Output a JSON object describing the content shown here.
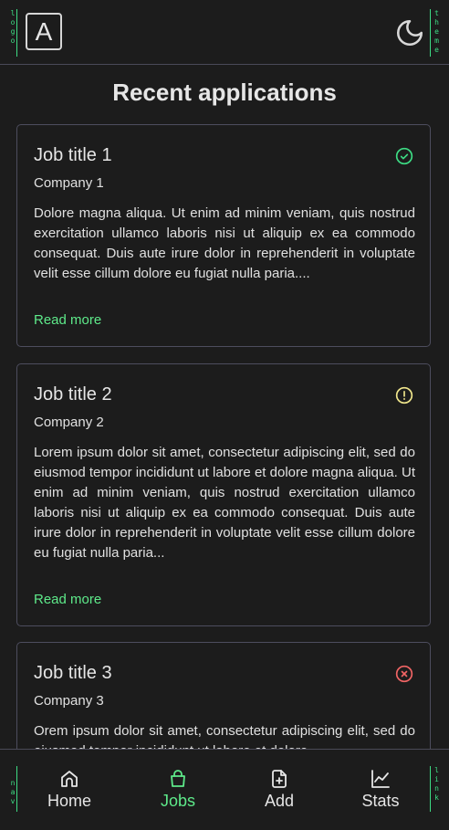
{
  "header": {
    "logo_letter": "A",
    "debug_left": [
      "l",
      "o",
      "g",
      "o"
    ],
    "debug_right": [
      "t",
      "h",
      "e",
      "m",
      "e"
    ]
  },
  "page_title": "Recent applications",
  "colors": {
    "background": "#1c1c1c",
    "accent": "#5eea8a",
    "success": "#3ddc84",
    "warning": "#f0e68c",
    "error": "#f06464"
  },
  "cards": [
    {
      "title": "Job title 1",
      "company": "Company 1",
      "description": "Dolore magna aliqua. Ut enim ad minim veniam, quis nostrud exercitation ullamco laboris nisi ut aliquip ex ea commodo consequat. Duis aute irure dolor in reprehenderit in voluptate velit esse cillum dolore eu fugiat nulla paria....",
      "read_more": "Read more",
      "status_icon": "check-circle-icon"
    },
    {
      "title": "Job title 2",
      "company": "Company 2",
      "description": "Lorem ipsum dolor sit amet, consectetur adipiscing elit, sed do eiusmod tempor incididunt ut labore et dolore magna aliqua. Ut enim ad minim veniam, quis nostrud exercitation ullamco laboris nisi ut aliquip ex ea commodo consequat. Duis aute irure dolor in reprehenderit in voluptate velit esse cillum dolore eu fugiat nulla paria...",
      "read_more": "Read more",
      "status_icon": "alert-circle-icon"
    },
    {
      "title": "Job title 3",
      "company": "Company 3",
      "description": "Orem ipsum dolor sit amet, consectetur adipiscing elit, sed do eiusmod tempor incididunt ut labore et dolore",
      "read_more": "Read more",
      "status_icon": "x-circle-icon"
    }
  ],
  "bottom_nav": {
    "debug_left": [
      "n",
      "a",
      "v"
    ],
    "debug_right": [
      "l",
      "i",
      "n",
      "k"
    ],
    "items": [
      {
        "label": "Home",
        "icon": "home-icon"
      },
      {
        "label": "Jobs",
        "icon": "bag-icon"
      },
      {
        "label": "Add",
        "icon": "file-plus-icon"
      },
      {
        "label": "Stats",
        "icon": "chart-line-icon"
      }
    ]
  }
}
